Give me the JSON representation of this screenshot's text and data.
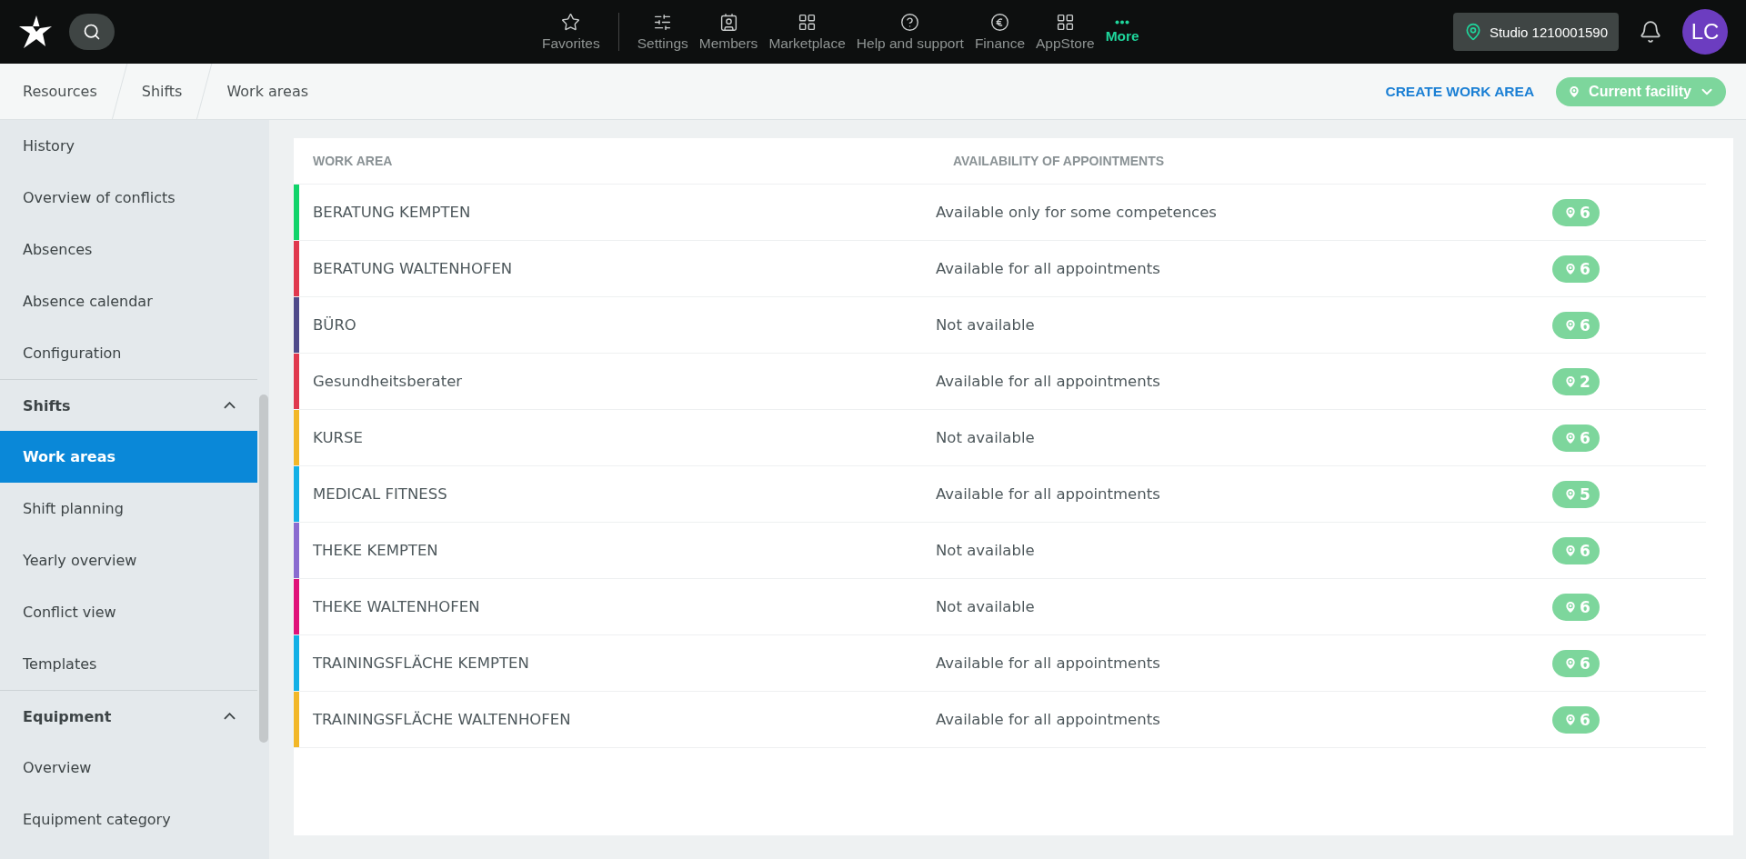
{
  "top_nav": {
    "items": [
      {
        "label": "Favorites",
        "selected": false
      },
      {
        "label": "Settings",
        "selected": false
      },
      {
        "label": "Members",
        "selected": false
      },
      {
        "label": "Marketplace",
        "selected": false
      },
      {
        "label": "Help and support",
        "selected": false
      },
      {
        "label": "Finance",
        "selected": false
      },
      {
        "label": "AppStore",
        "selected": false
      },
      {
        "label": "More",
        "selected": true
      }
    ],
    "studio": "Studio 1210001590",
    "avatar": "LC"
  },
  "breadcrumbs": [
    "Resources",
    "Shifts",
    "Work areas"
  ],
  "actions": {
    "create": "CREATE WORK AREA",
    "facility": "Current facility"
  },
  "sidebar": {
    "items": [
      {
        "kind": "item",
        "label": "History",
        "selected": false
      },
      {
        "kind": "item",
        "label": "Overview of conflicts",
        "selected": false
      },
      {
        "kind": "item",
        "label": "Absences",
        "selected": false
      },
      {
        "kind": "item",
        "label": "Absence calendar",
        "selected": false
      },
      {
        "kind": "item",
        "label": "Configuration",
        "selected": false
      },
      {
        "kind": "section",
        "label": "Shifts",
        "expanded": true
      },
      {
        "kind": "item",
        "label": "Work areas",
        "selected": true
      },
      {
        "kind": "item",
        "label": "Shift planning",
        "selected": false
      },
      {
        "kind": "item",
        "label": "Yearly overview",
        "selected": false
      },
      {
        "kind": "item",
        "label": "Conflict view",
        "selected": false
      },
      {
        "kind": "item",
        "label": "Templates",
        "selected": false
      },
      {
        "kind": "section",
        "label": "Equipment",
        "expanded": true
      },
      {
        "kind": "item",
        "label": "Overview",
        "selected": false
      },
      {
        "kind": "item",
        "label": "Equipment category",
        "selected": false
      }
    ]
  },
  "table": {
    "columns": [
      "WORK AREA",
      "AVAILABILITY OF APPOINTMENTS"
    ],
    "rows": [
      {
        "name": "BERATUNG KEMPTEN",
        "availability": "Available only for some competences",
        "facilities": "6",
        "color": "#10d46a"
      },
      {
        "name": "BERATUNG WALTENHOFEN",
        "availability": "Available for all appointments",
        "facilities": "6",
        "color": "#e0384e"
      },
      {
        "name": "BÜRO",
        "availability": "Not available",
        "facilities": "6",
        "color": "#4f4a8a"
      },
      {
        "name": "Gesundheitsberater",
        "availability": "Available for all appointments",
        "facilities": "2",
        "color": "#e0384e"
      },
      {
        "name": "KURSE",
        "availability": "Not available",
        "facilities": "6",
        "color": "#f2b728"
      },
      {
        "name": "MEDICAL FITNESS",
        "availability": "Available for all appointments",
        "facilities": "5",
        "color": "#12b0e6"
      },
      {
        "name": "THEKE KEMPTEN",
        "availability": "Not available",
        "facilities": "6",
        "color": "#8a6bd0"
      },
      {
        "name": "THEKE WALTENHOFEN",
        "availability": "Not available",
        "facilities": "6",
        "color": "#e0127a"
      },
      {
        "name": "TRAININGSFLÄCHE KEMPTEN",
        "availability": "Available for all appointments",
        "facilities": "6",
        "color": "#12b0e6"
      },
      {
        "name": "TRAININGSFLÄCHE WALTENHOFEN",
        "availability": "Available for all appointments",
        "facilities": "6",
        "color": "#f2b728"
      }
    ]
  }
}
